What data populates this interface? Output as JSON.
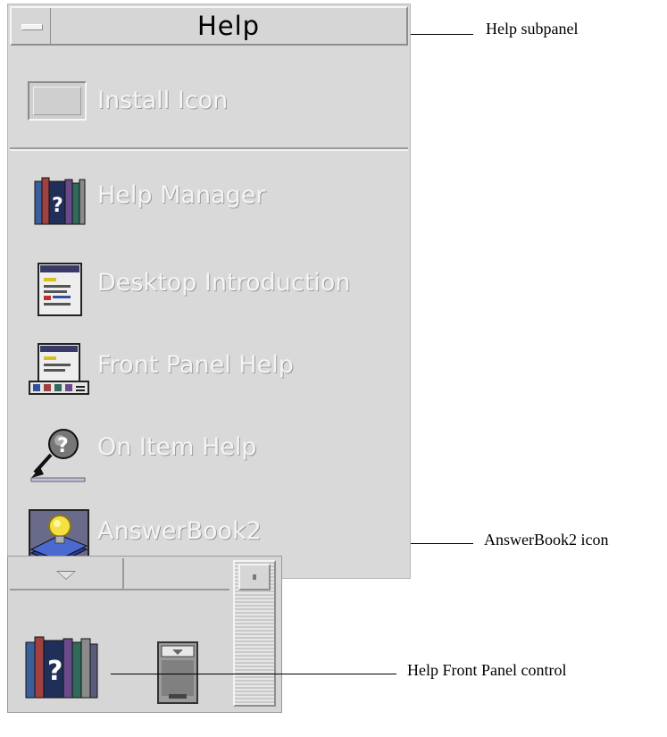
{
  "subpanel": {
    "title": "Help",
    "install_label": "Install Icon",
    "items": [
      {
        "label": "Help Manager",
        "icon": "help-manager-icon"
      },
      {
        "label": "Desktop Introduction",
        "icon": "desktop-introduction-icon"
      },
      {
        "label": "Front Panel Help",
        "icon": "front-panel-help-icon"
      },
      {
        "label": "On Item Help",
        "icon": "on-item-help-icon"
      },
      {
        "label": "AnswerBook2",
        "icon": "answerbook2-icon"
      }
    ]
  },
  "front_panel": {
    "arrow": "triangle-down-icon",
    "controls": [
      "help-books-icon",
      "printer-icon"
    ]
  },
  "callouts": {
    "help_subpanel": "Help subpanel",
    "answerbook2_icon": "AnswerBook2 icon",
    "help_front_panel_control": "Help Front Panel control"
  },
  "colors": {
    "panel_bg": "#d9d9d9",
    "label_text": "#f4f4f4",
    "title_text": "#000000"
  }
}
